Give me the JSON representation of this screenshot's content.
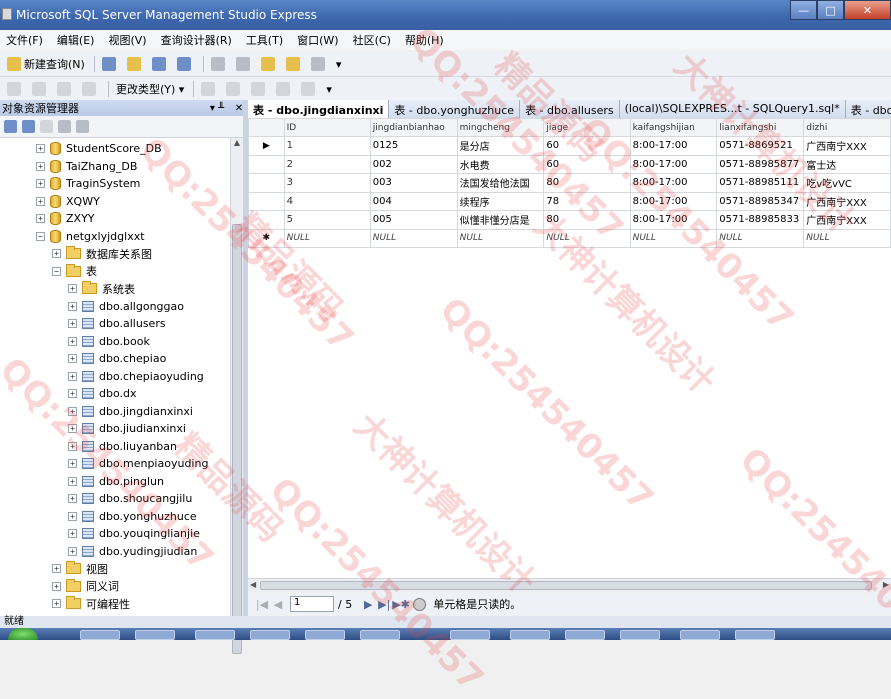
{
  "window": {
    "title": "Microsoft SQL Server Management Studio Express",
    "minimize": "—",
    "maximize": "□",
    "close": "✕"
  },
  "menu": [
    "文件(F)",
    "编辑(E)",
    "视图(V)",
    "查询设计器(R)",
    "工具(T)",
    "窗口(W)",
    "社区(C)",
    "帮助(H)"
  ],
  "toolbar1": {
    "new_query": "新建查询(N)"
  },
  "toolbar2": {
    "change_type": "更改类型(Y) ▾"
  },
  "object_explorer": {
    "title": "对象资源管理器",
    "pin": "▾ ╨",
    "close": "✕",
    "items": [
      {
        "label": "StudentScore_DB",
        "kind": "db",
        "expander": "+",
        "level": 0
      },
      {
        "label": "TaiZhang_DB",
        "kind": "db",
        "expander": "+",
        "level": 0
      },
      {
        "label": "TraginSystem",
        "kind": "db",
        "expander": "+",
        "level": 0
      },
      {
        "label": "XQWY",
        "kind": "db",
        "expander": "+",
        "level": 0
      },
      {
        "label": "ZXYY",
        "kind": "db",
        "expander": "+",
        "level": 0
      },
      {
        "label": "netgxlyjdglxxt",
        "kind": "db",
        "expander": "−",
        "level": 0
      },
      {
        "label": "数据库关系图",
        "kind": "folder",
        "expander": "+",
        "level": 1
      },
      {
        "label": "表",
        "kind": "folder",
        "expander": "−",
        "level": 1
      },
      {
        "label": "系统表",
        "kind": "folder",
        "expander": "+",
        "level": 2
      },
      {
        "label": "dbo.allgonggao",
        "kind": "table",
        "expander": "+",
        "level": 2
      },
      {
        "label": "dbo.allusers",
        "kind": "table",
        "expander": "+",
        "level": 2
      },
      {
        "label": "dbo.book",
        "kind": "table",
        "expander": "+",
        "level": 2
      },
      {
        "label": "dbo.chepiao",
        "kind": "table",
        "expander": "+",
        "level": 2
      },
      {
        "label": "dbo.chepiaoyuding",
        "kind": "table",
        "expander": "+",
        "level": 2
      },
      {
        "label": "dbo.dx",
        "kind": "table",
        "expander": "+",
        "level": 2
      },
      {
        "label": "dbo.jingdianxinxi",
        "kind": "table",
        "expander": "+",
        "level": 2
      },
      {
        "label": "dbo.jiudianxinxi",
        "kind": "table",
        "expander": "+",
        "level": 2
      },
      {
        "label": "dbo.liuyanban",
        "kind": "table",
        "expander": "+",
        "level": 2
      },
      {
        "label": "dbo.menpiaoyuding",
        "kind": "table",
        "expander": "+",
        "level": 2
      },
      {
        "label": "dbo.pinglun",
        "kind": "table",
        "expander": "+",
        "level": 2
      },
      {
        "label": "dbo.shoucangjilu",
        "kind": "table",
        "expander": "+",
        "level": 2
      },
      {
        "label": "dbo.yonghuzhuce",
        "kind": "table",
        "expander": "+",
        "level": 2
      },
      {
        "label": "dbo.youqinglianjie",
        "kind": "table",
        "expander": "+",
        "level": 2
      },
      {
        "label": "dbo.yudingjiudian",
        "kind": "table",
        "expander": "+",
        "level": 2
      },
      {
        "label": "视图",
        "kind": "folder",
        "expander": "+",
        "level": 1
      },
      {
        "label": "同义词",
        "kind": "folder",
        "expander": "+",
        "level": 1
      },
      {
        "label": "可编程性",
        "kind": "folder",
        "expander": "+",
        "level": 1
      }
    ]
  },
  "tabs": [
    {
      "label": "表 - dbo.jingdianxinxi",
      "active": true
    },
    {
      "label": "表 - dbo.yonghuzhuce",
      "active": false
    },
    {
      "label": "表 - dbo.allusers",
      "active": false
    },
    {
      "label": "(local)\\SQLEXPRES...t - SQLQuery1.sql*",
      "active": false
    },
    {
      "label": "表 - dbo.<%=",
      "active": false
    }
  ],
  "grid": {
    "columns": [
      "ID",
      "jingdianbianhao",
      "mingcheng",
      "jiage",
      "kaifangshijian",
      "lianxifangshi",
      "dizhi"
    ],
    "rows": [
      {
        "indicator": "▶",
        "cells": [
          "1",
          "0125",
          "是分店",
          "60",
          "8:00-17:00",
          "0571-8869521",
          "广西南宁XXX"
        ]
      },
      {
        "indicator": "",
        "cells": [
          "2",
          "002",
          "水电费",
          "60",
          "8:00-17:00",
          "0571-88985877",
          "富士达"
        ]
      },
      {
        "indicator": "",
        "cells": [
          "3",
          "003",
          "法国发给他法国",
          "80",
          "8:00-17:00",
          "0571-88985111",
          "吃v吃vVC"
        ]
      },
      {
        "indicator": "",
        "cells": [
          "4",
          "004",
          "续程序",
          "78",
          "8:00-17:00",
          "0571-88985347",
          "广西南宁XXX"
        ]
      },
      {
        "indicator": "",
        "cells": [
          "5",
          "005",
          "似懂非懂分店是",
          "80",
          "8:00-17:00",
          "0571-88985833",
          "广西南宁XXX"
        ]
      },
      {
        "indicator": "✱",
        "cells": [
          "NULL",
          "NULL",
          "NULL",
          "NULL",
          "NULL",
          "NULL",
          "NULL"
        ]
      }
    ]
  },
  "navigator": {
    "page": "1",
    "of": "/ 5",
    "message": "单元格是只读的。"
  },
  "status": "就绪",
  "watermarks": [
    "QQ:254540457",
    "大神计算机设计",
    "精品源码"
  ]
}
